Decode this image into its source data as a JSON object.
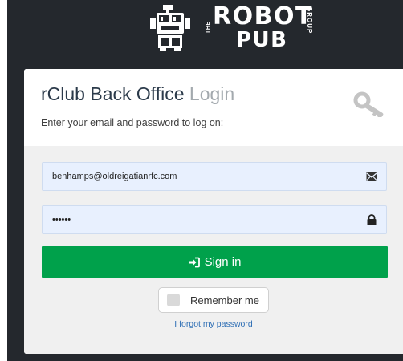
{
  "brand": {
    "logo_icon": "robot-pub-logo-icon",
    "the_text": "THE",
    "name_line1": "ROBOT",
    "name_line2": "PUB",
    "group_text": "GROUP"
  },
  "login": {
    "title_strong": "rClub Back Office",
    "title_light": "Login",
    "subtitle": "Enter your email and password to log on:",
    "header_icon": "key-icon",
    "email": {
      "value": "benhamps@oldreigatianrfc.com",
      "icon": "envelope-icon"
    },
    "password": {
      "value": "123456",
      "icon": "lock-icon"
    },
    "signin": {
      "label": "Sign in",
      "icon": "sign-in-icon"
    },
    "remember_label": "Remember me",
    "forgot_label": "I forgot my password"
  },
  "colors": {
    "background": "#24282d",
    "primary_button": "#00a14b",
    "link": "#2f6fb5",
    "input_background": "#e8f0fe"
  }
}
